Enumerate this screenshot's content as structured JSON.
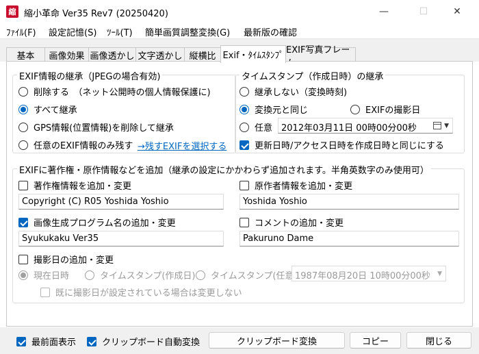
{
  "window": {
    "title": "縮小革命 Ver35 Rev7 (20250420)",
    "icon_char": "縮",
    "minimize_icon": "—",
    "maximize_icon": "☐",
    "close_icon": "✕"
  },
  "menu": [
    "ﾌｧｲﾙ(F)",
    "設定記憶(S)",
    "ﾂｰﾙ(T)",
    "簡単画質調整変換(G)",
    "最新版の確認"
  ],
  "tabs": [
    "基本",
    "画像効果",
    "画像透かし",
    "文字透かし",
    "縦横比",
    "Exif・ﾀｲﾑｽﾀﾝﾌﾟ",
    "EXIF写真フレーム"
  ],
  "active_tab": "Exif・ﾀｲﾑｽﾀﾝﾌﾟ",
  "exif_inherit": {
    "title": "EXIF情報の継承（JPEGの場合有効)",
    "options": [
      "削除する　（ネット公開時の個人情報保護に)",
      "すべて継承",
      "GPS情報(位置情報)を削除して継承",
      "任意のEXIF情報のみ残す"
    ],
    "selected": "すべて継承",
    "select_link": "→残すEXIFを選択する"
  },
  "timestamp_inherit": {
    "title": "タイムスタンプ（作成日時）の継承",
    "option_none": "継承しない（変換時刻)",
    "option_same": "変換元と同じ",
    "option_exif": "EXIFの撮影日",
    "option_any": "任意",
    "selected": "変換元と同じ",
    "datetime_value": "2012年03月11日 00時00分00秒",
    "update_same_label": "更新日時/アクセス日時を作成日時と同じにする",
    "update_same_checked": true
  },
  "copyright_group": {
    "title": "EXIFに著作権・原作情報などを追加（継承の設定にかかわらず追加されます。半角英数字のみ使用可）",
    "copyright_label": "著作権情報を追加・変更",
    "copyright_checked": false,
    "copyright_value": "Copyright (C) R05 Yoshida Yoshio",
    "author_label": "原作者情報を追加・変更",
    "author_checked": false,
    "author_value": "Yoshida Yoshio",
    "program_label": "画像生成プログラム名の追加・変更",
    "program_checked": true,
    "program_value": "Syukukaku Ver35",
    "comment_label": "コメントの追加・変更",
    "comment_checked": false,
    "comment_value": "Pakuruno Dame",
    "shoot_date_label": "撮影日の追加・変更",
    "shoot_date_checked": false,
    "opt_now": "現在日時",
    "opt_ts_created": "タイムスタンプ(作成日)",
    "opt_ts_any": "タイムスタンプ(任意)",
    "shoot_date_value": "1987年08月20日 10時00分00秒",
    "no_change_label": "既に撮影日が設定されている場合は変更しない"
  },
  "bottom": {
    "topmost_label": "最前面表示",
    "topmost_checked": true,
    "clipboard_auto_label": "クリップボード自動変換",
    "clipboard_auto_checked": true,
    "clipboard_convert_button": "クリップボード変換",
    "copy_button": "コピー",
    "close_button": "閉じる"
  },
  "colors": {
    "accent": "#0067c0",
    "app_icon": "#c8102e",
    "chrome": "#f0f0f0"
  }
}
